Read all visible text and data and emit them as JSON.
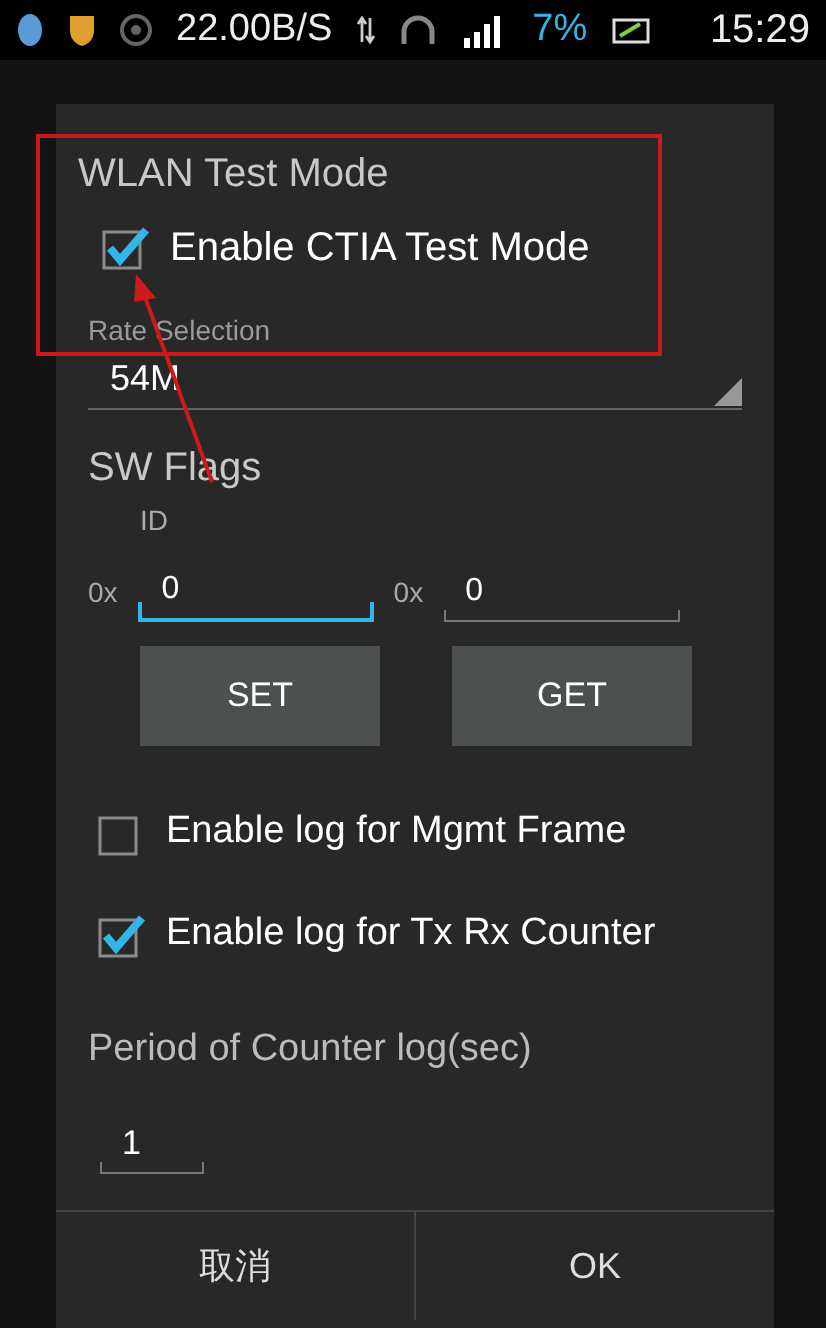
{
  "status_bar": {
    "net_speed": "22.00B/S",
    "battery": "7%",
    "time": "15:29"
  },
  "dialog": {
    "title": "WLAN Test Mode",
    "ctia": {
      "label": "Enable CTIA Test Mode",
      "checked": true
    },
    "rate": {
      "label": "Rate Selection",
      "value": "54M"
    },
    "sw_flags": {
      "title": "SW Flags",
      "id_label": "ID",
      "fields": [
        {
          "prefix": "0x",
          "value": "0",
          "focused": true
        },
        {
          "prefix": "0x",
          "value": "0",
          "focused": false
        }
      ],
      "buttons": [
        "SET",
        "GET"
      ]
    },
    "log_options": [
      {
        "label": "Enable log for Mgmt Frame",
        "checked": false
      },
      {
        "label": "Enable log for Tx Rx Counter",
        "checked": true
      }
    ],
    "period": {
      "label": "Period of Counter log(sec)",
      "value": "1"
    },
    "actions": [
      "取消",
      "OK"
    ]
  }
}
